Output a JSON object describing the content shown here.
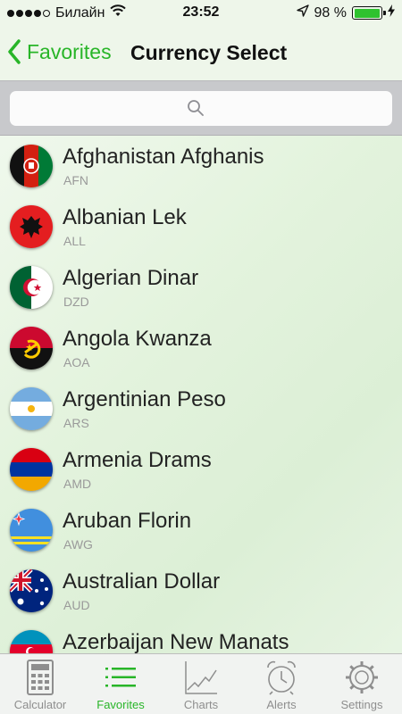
{
  "status_bar": {
    "carrier": "Билайн",
    "time": "23:52",
    "battery": "98 %",
    "battery_level": 0.98
  },
  "nav": {
    "back_label": "Favorites",
    "title": "Currency Select"
  },
  "search": {
    "placeholder": ""
  },
  "currencies": [
    {
      "name": "Afghanistan Afghanis",
      "code": "AFN"
    },
    {
      "name": "Albanian Lek",
      "code": "ALL"
    },
    {
      "name": "Algerian Dinar",
      "code": "DZD"
    },
    {
      "name": "Angola Kwanza",
      "code": "AOA"
    },
    {
      "name": "Argentinian Peso",
      "code": "ARS"
    },
    {
      "name": "Armenia Drams",
      "code": "AMD"
    },
    {
      "name": "Aruban Florin",
      "code": "AWG"
    },
    {
      "name": "Australian Dollar",
      "code": "AUD"
    },
    {
      "name": "Azerbaijan New Manats",
      "code": ""
    }
  ],
  "tabs": [
    {
      "label": "Calculator",
      "icon": "calculator-icon"
    },
    {
      "label": "Favorites",
      "icon": "list-icon",
      "active": true
    },
    {
      "label": "Charts",
      "icon": "chart-icon"
    },
    {
      "label": "Alerts",
      "icon": "alarm-clock-icon"
    },
    {
      "label": "Settings",
      "icon": "gear-icon"
    }
  ],
  "colors": {
    "accent": "#28b528",
    "tab_inactive": "#8e8e8e"
  }
}
